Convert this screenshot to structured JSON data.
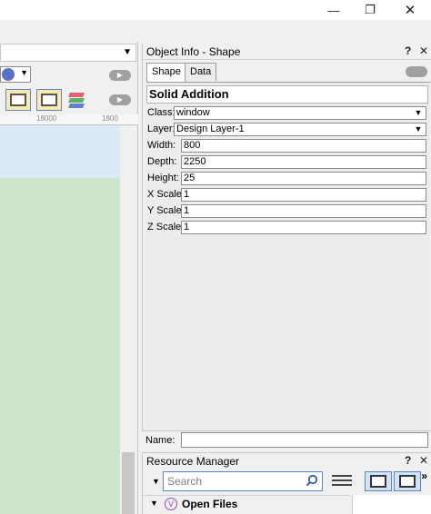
{
  "window": {
    "controls": {
      "minimize": "—",
      "maximize": "❐",
      "close": "✕"
    }
  },
  "left_pane": {
    "ruler_ticks": [
      "18000",
      "1800"
    ]
  },
  "object_info": {
    "title": "Object Info - Shape",
    "help": "?",
    "close": "✕",
    "tabs": [
      {
        "label": "Shape",
        "active": true
      },
      {
        "label": "Data",
        "active": false
      }
    ],
    "object_type": "Solid Addition",
    "fields": [
      {
        "label": "Class:",
        "value": "window",
        "kind": "select"
      },
      {
        "label": "Layer:",
        "value": "Design Layer-1",
        "kind": "select"
      },
      {
        "label": "Width:",
        "value": "800",
        "kind": "text"
      },
      {
        "label": "Depth:",
        "value": "2250",
        "kind": "text"
      },
      {
        "label": "Height:",
        "value": "25",
        "kind": "text"
      },
      {
        "label": "X Scale:",
        "value": "1",
        "kind": "text"
      },
      {
        "label": "Y Scale:",
        "value": "1",
        "kind": "text"
      },
      {
        "label": "Z Scale:",
        "value": "1",
        "kind": "text"
      }
    ],
    "name_label": "Name:",
    "name_value": ""
  },
  "resource_manager": {
    "title": "Resource Manager",
    "help": "?",
    "close": "✕",
    "search_placeholder": "Search",
    "more": "»",
    "tree": {
      "label": "Open Files",
      "icon_letter": "V"
    }
  },
  "colors": {
    "canvas_blue": "#dbeaf6",
    "canvas_green": "#cce5cc",
    "accent_border": "#5b83c7",
    "toggle_active_bg": "#fce9b0"
  }
}
